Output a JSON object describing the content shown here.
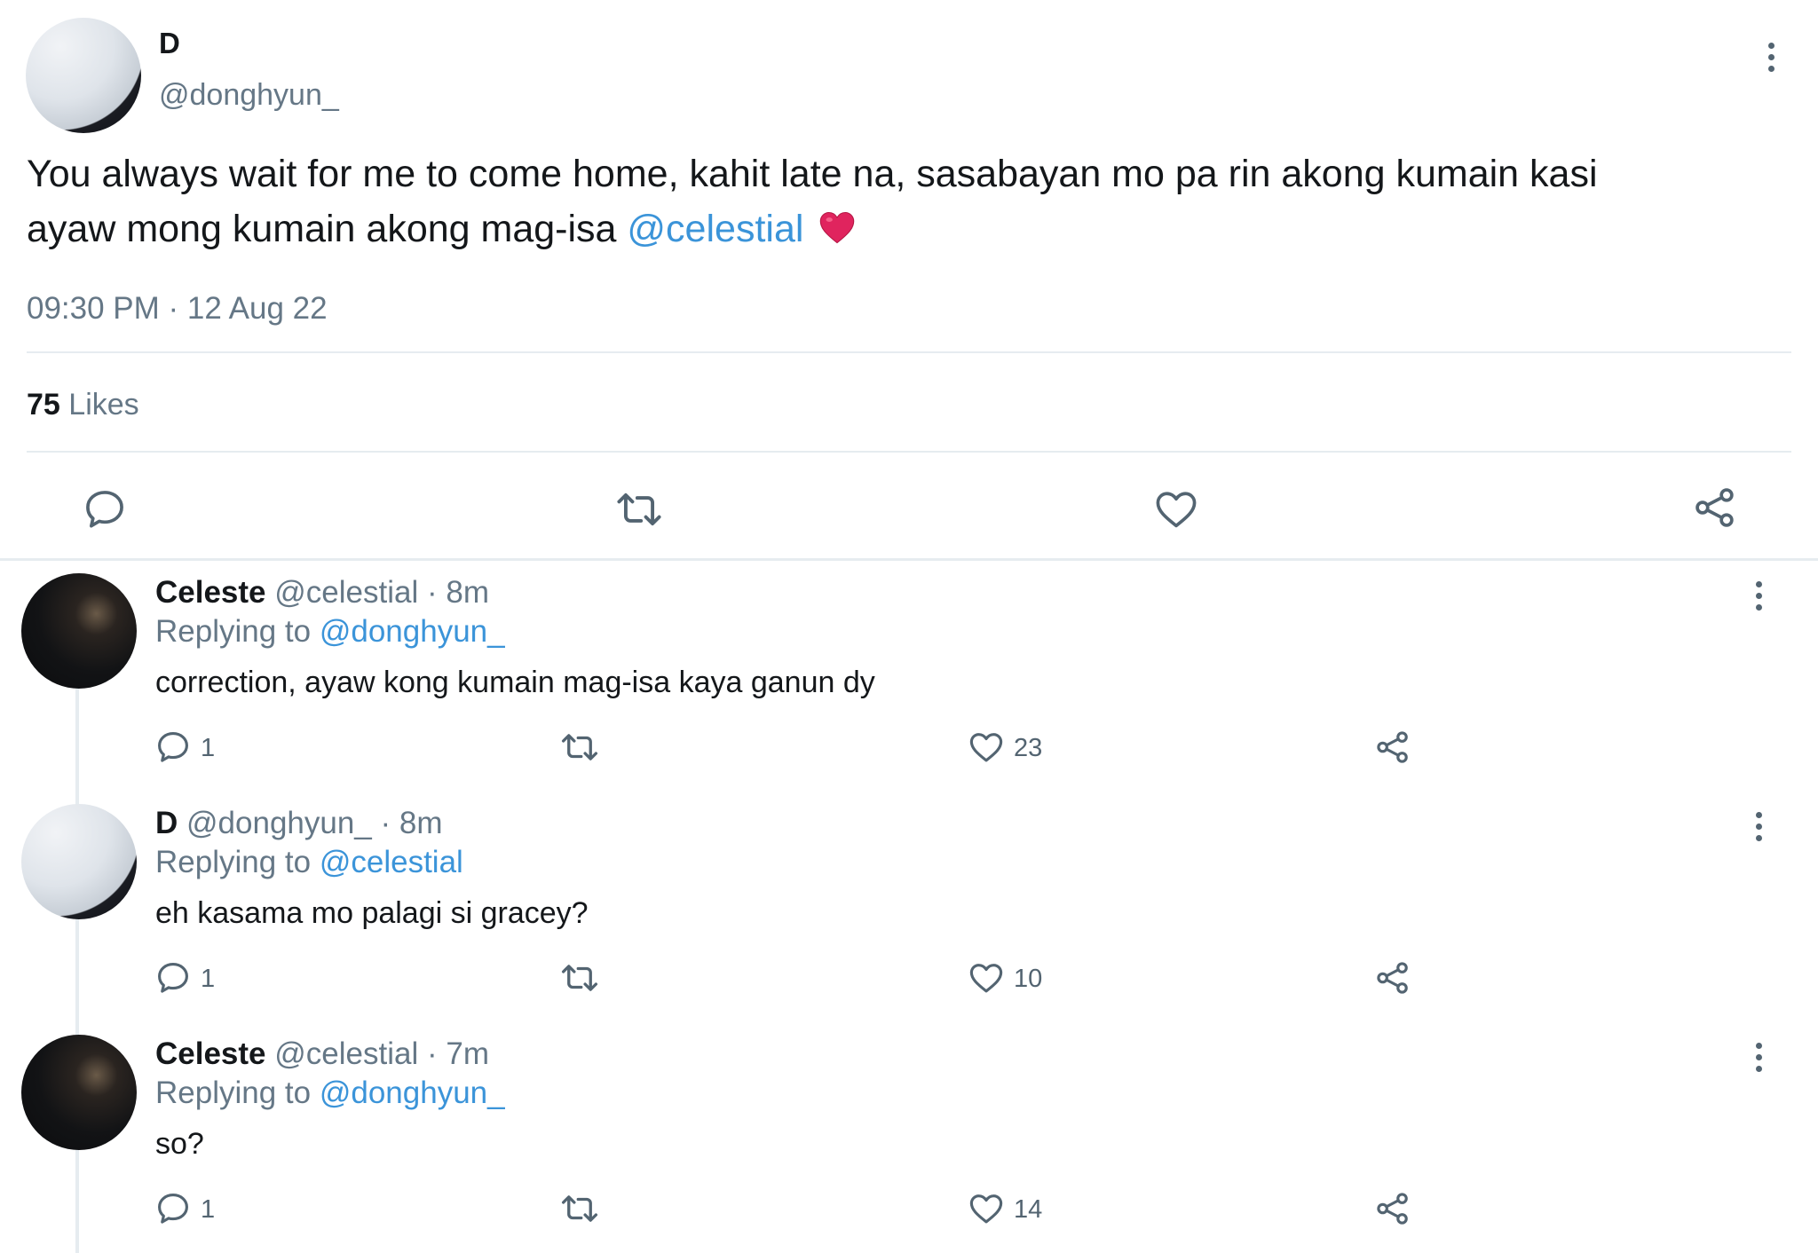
{
  "main_tweet": {
    "display_name": "D",
    "handle": "@donghyun_",
    "text_line1": "You  always wait for me to come home, kahit late na, sasabayan mo pa rin akong kumain kasi",
    "text_line2_prefix": "ayaw mong kumain akong mag-isa",
    "mention": "@celestial",
    "emoji": "❤️",
    "timestamp": "09:30 PM · 12 Aug 22",
    "likes_count": "75",
    "likes_label": "Likes"
  },
  "replies": [
    {
      "display_name": "Celeste",
      "handle": "@celestial",
      "time": "· 8m",
      "replying_prefix": "Replying to",
      "replying_to": "@donghyun_",
      "text": "correction, ayaw kong kumain mag-isa kaya ganun dy",
      "reply_count": "1",
      "like_count": "23"
    },
    {
      "display_name": "D",
      "handle": "@donghyun_",
      "time": "· 8m",
      "replying_prefix": "Replying to",
      "replying_to": "@celestial",
      "text": "eh kasama mo palagi si gracey?",
      "reply_count": "1",
      "like_count": "10"
    },
    {
      "display_name": "Celeste",
      "handle": "@celestial",
      "time": "· 7m",
      "replying_prefix": "Replying to",
      "replying_to": "@donghyun_",
      "text": "so?",
      "reply_count": "1",
      "like_count": "14"
    }
  ],
  "colors": {
    "link": "#3b94d9",
    "secondary_text": "#657786",
    "icon": "#536471",
    "heart_emoji": "#e0245e"
  },
  "icons": [
    "reply-icon",
    "retweet-icon",
    "like-icon",
    "share-icon",
    "more-icon"
  ]
}
